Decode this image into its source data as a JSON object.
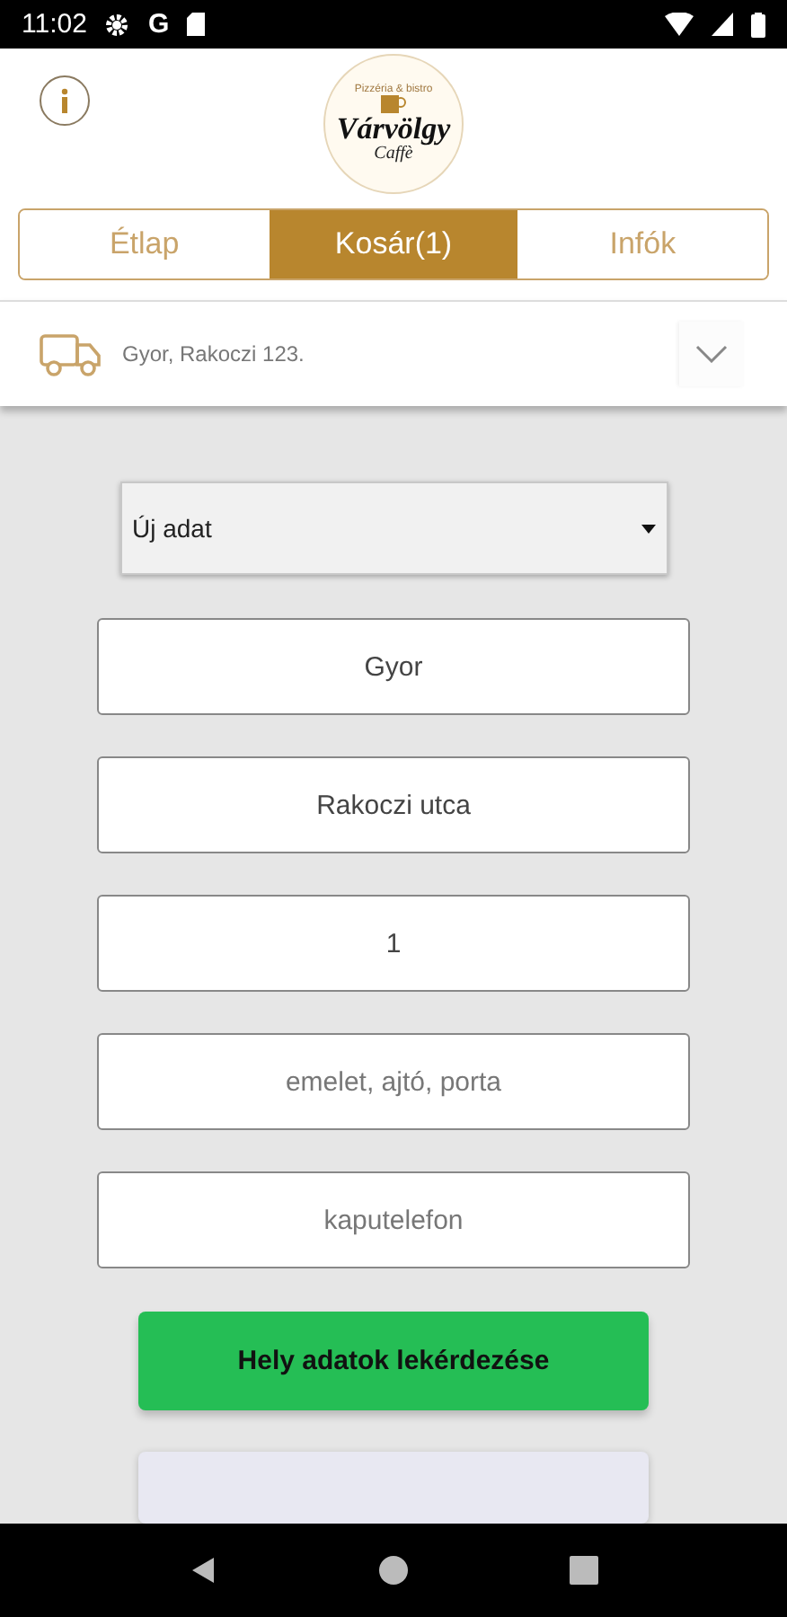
{
  "status_bar": {
    "time": "11:02",
    "g_letter": "G"
  },
  "logo": {
    "top_text": "Pizzéria & bistro",
    "name": "Várvölgy",
    "sub": "Caffè"
  },
  "tabs": [
    {
      "label": "Étlap",
      "selected": false
    },
    {
      "label": "Kosár(1)",
      "selected": true
    },
    {
      "label": "Infók",
      "selected": false
    }
  ],
  "address": {
    "text": "Gyor, Rakoczi 123.",
    "expanded": false
  },
  "form": {
    "dropdown": {
      "value": "Új adat"
    },
    "fields": [
      {
        "value": "Gyor"
      },
      {
        "value": "Rakoczi utca"
      },
      {
        "value": "1"
      },
      {
        "placeholder": "emelet, ajtó, porta"
      },
      {
        "placeholder": "kaputelefon"
      }
    ],
    "locate_button": "Hely adatok lekérdezése"
  }
}
